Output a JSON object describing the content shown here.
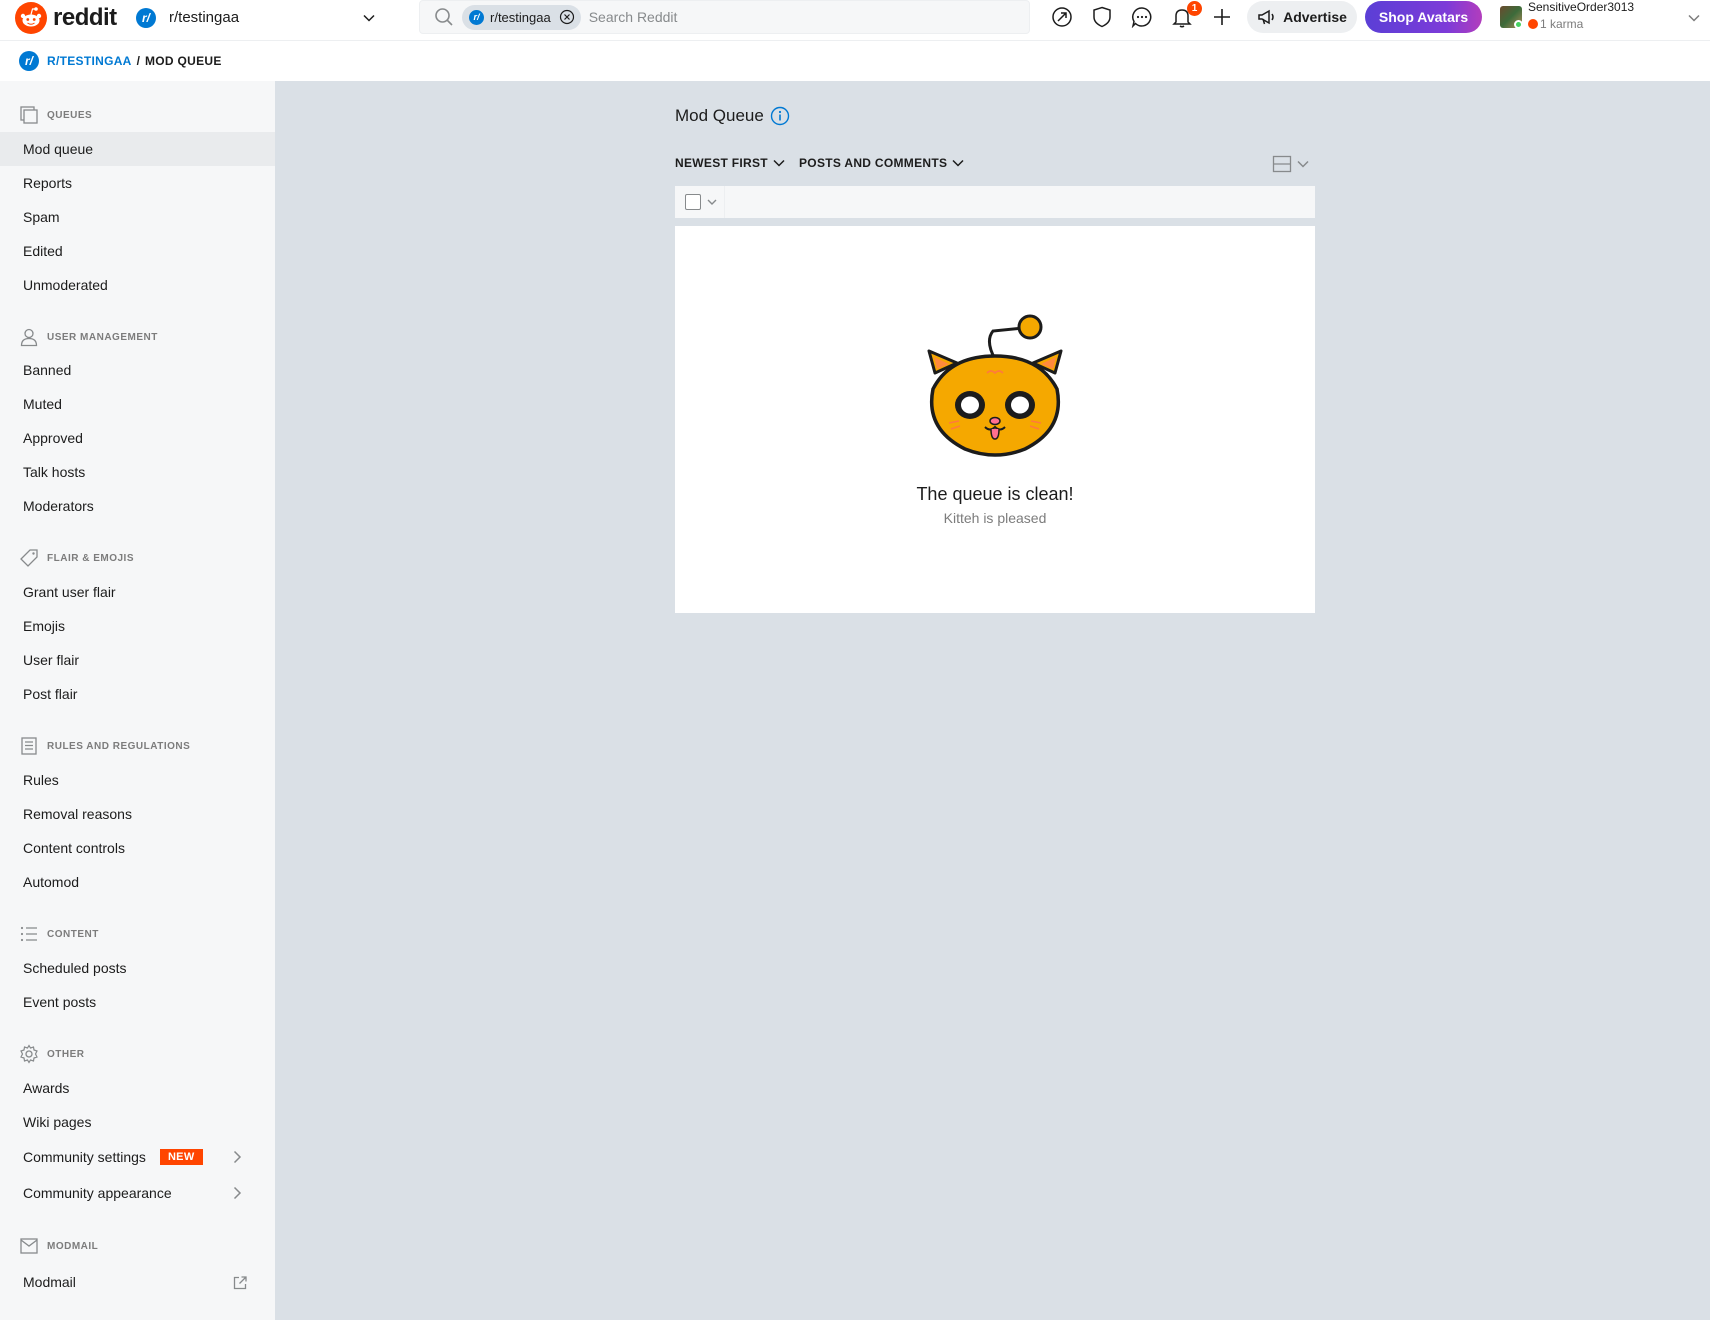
{
  "brand": {
    "name": "reddit",
    "accent": "#ff4500"
  },
  "header": {
    "community": "r/testingaa",
    "search": {
      "chip": "r/testingaa",
      "placeholder": "Search Reddit"
    },
    "notification_count": "1",
    "advertise_label": "Advertise",
    "shop_label": "Shop Avatars",
    "user": {
      "name": "SensitiveOrder3013",
      "karma": "1 karma"
    }
  },
  "breadcrumb": {
    "community": "R/TESTINGAA",
    "separator": "/",
    "current": "MOD QUEUE"
  },
  "sidebar": {
    "sections": [
      {
        "title": "QUEUES",
        "icon": "queue-icon",
        "items": [
          "Mod queue",
          "Reports",
          "Spam",
          "Edited",
          "Unmoderated"
        ]
      },
      {
        "title": "USER MANAGEMENT",
        "icon": "user-icon",
        "items": [
          "Banned",
          "Muted",
          "Approved",
          "Talk hosts",
          "Moderators"
        ]
      },
      {
        "title": "FLAIR & EMOJIS",
        "icon": "tag-icon",
        "items": [
          "Grant user flair",
          "Emojis",
          "User flair",
          "Post flair"
        ]
      },
      {
        "title": "RULES AND REGULATIONS",
        "icon": "rules-icon",
        "items": [
          "Rules",
          "Removal reasons",
          "Content controls",
          "Automod"
        ]
      },
      {
        "title": "CONTENT",
        "icon": "list-icon",
        "items": [
          "Scheduled posts",
          "Event posts"
        ]
      },
      {
        "title": "OTHER",
        "icon": "gear-icon",
        "items": [
          "Awards",
          "Wiki pages",
          "Community settings",
          "Community appearance"
        ],
        "new_badge": "NEW"
      },
      {
        "title": "MODMAIL",
        "icon": "mail-icon",
        "items": [
          "Modmail"
        ]
      }
    ]
  },
  "main": {
    "title": "Mod Queue",
    "sort_label": "NEWEST FIRST",
    "type_label": "POSTS AND COMMENTS",
    "empty_title": "The queue is clean!",
    "empty_subtitle": "Kitteh is pleased"
  }
}
